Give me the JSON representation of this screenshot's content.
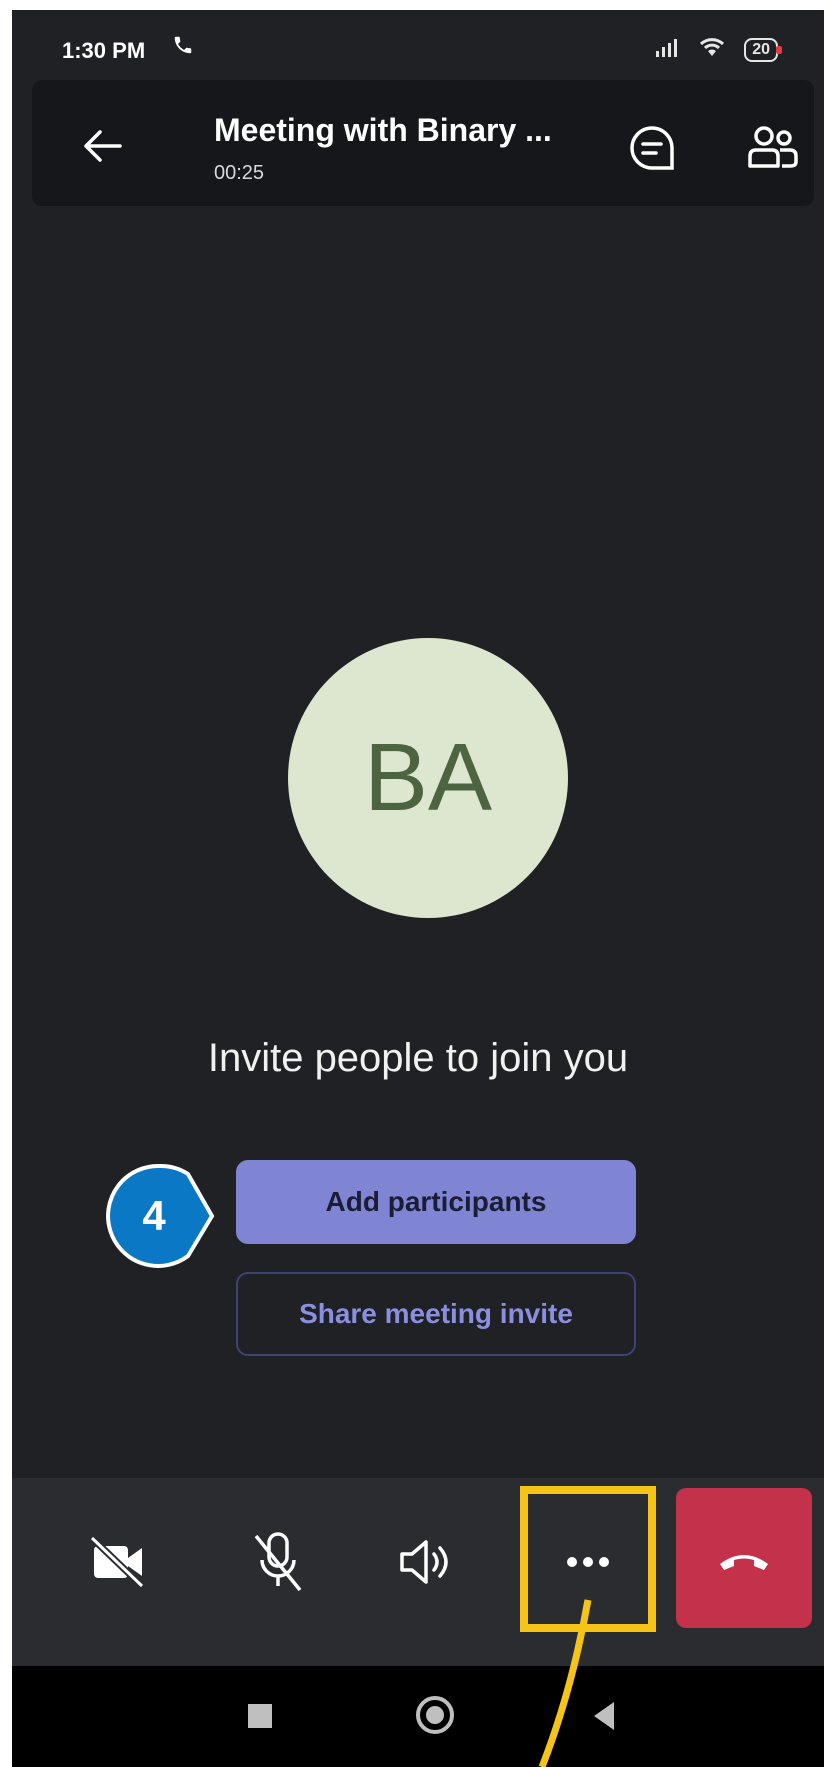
{
  "status_bar": {
    "time": "1:30 PM",
    "battery": "20"
  },
  "header": {
    "title": "Meeting with Binary ...",
    "timer": "00:25"
  },
  "participant": {
    "initials": "BA"
  },
  "invite": {
    "text": "Invite people to join you",
    "add_participants_label": "Add participants",
    "share_invite_label": "Share meeting invite"
  },
  "annotation": {
    "step_number": "4",
    "callout_color": "#0a78c4",
    "highlight_color": "#f6c417"
  },
  "colors": {
    "background": "#202124",
    "accent": "#7f85d3",
    "hangup": "#c4314b",
    "avatar_bg": "#dde7cf"
  },
  "icons": [
    "back-arrow-icon",
    "chat-icon",
    "people-icon",
    "video-off-icon",
    "mic-off-icon",
    "speaker-icon",
    "more-icon",
    "hang-up-icon"
  ]
}
